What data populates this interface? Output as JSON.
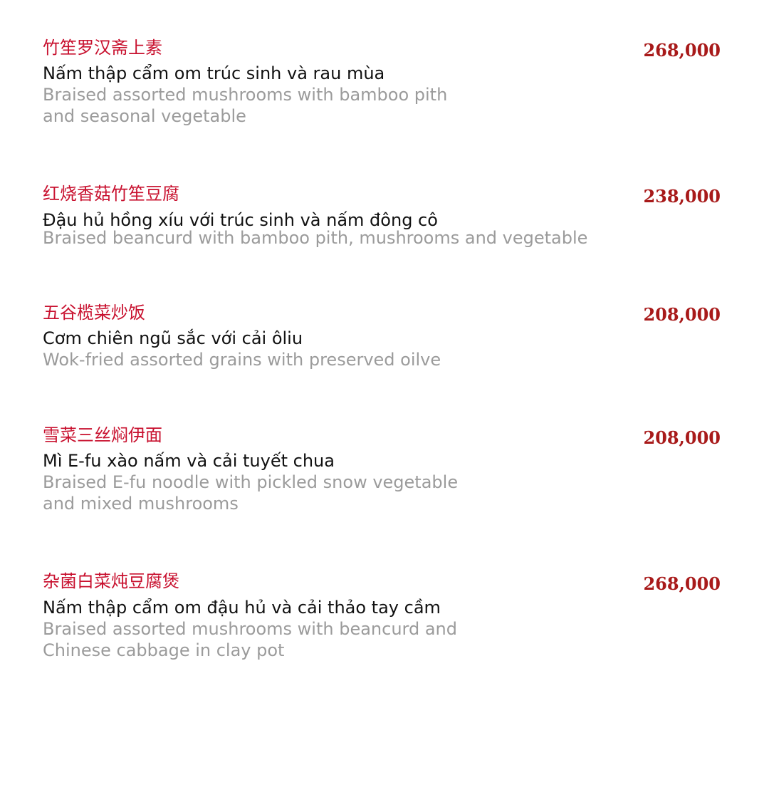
{
  "items": [
    {
      "chinese": "竹笙罗汉斋上素",
      "vietnamese": "Nấm thập cẩm om trúc sinh và rau mùa",
      "english": "Braised assorted mushrooms with bamboo pith\nand seasonal vegetable",
      "price": "268,000"
    },
    {
      "chinese": "红烧香菇竹笙豆腐",
      "vietnamese": "Đậu hủ hồng xíu với trúc sinh và nấm đông cô",
      "english": "Braised beancurd with bamboo pith, mushrooms and vegetable",
      "price": "238,000"
    },
    {
      "chinese": "五谷榄菜炒饭",
      "vietnamese": "Cơm chiên ngũ sắc với cải ôliu",
      "english": "Wok-fried assorted grains with preserved oilve",
      "price": "208,000"
    },
    {
      "chinese": "雪菜三丝焖伊面",
      "vietnamese": "Mì E-fu xào nấm và cải tuyết chua",
      "english": "Braised E-fu noodle with pickled snow vegetable\nand mixed mushrooms",
      "price": "208,000"
    },
    {
      "chinese": "杂菌白菜炖豆腐煲",
      "vietnamese": "Nấm thập cẩm om đậu hủ và cải thảo tay cầm",
      "english": "Braised assorted mushrooms with beancurd and\nChinese cabbage in clay pot",
      "price": "268,000"
    }
  ]
}
